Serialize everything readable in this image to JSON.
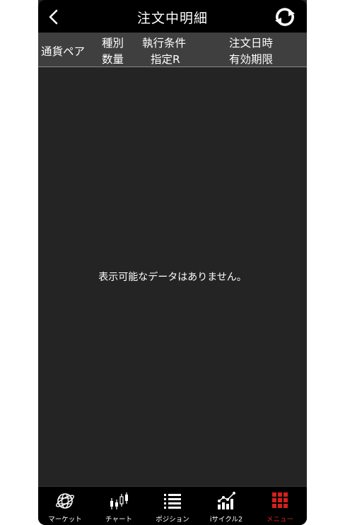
{
  "nav": {
    "title": "注文中明細"
  },
  "header": {
    "col1_line1": "通貨ペア",
    "col2_line1": "種別",
    "col2_line2": "数量",
    "col3_line1": "執行条件",
    "col3_line2": "指定R",
    "col4_line1": "注文日時",
    "col4_line2": "有効期限"
  },
  "content": {
    "empty_message": "表示可能なデータはありません。"
  },
  "tabs": [
    {
      "label": "マーケット",
      "icon": "globe-icon",
      "active": false
    },
    {
      "label": "チャート",
      "icon": "candlestick-icon",
      "active": false
    },
    {
      "label": "ポジション",
      "icon": "list-icon",
      "active": false
    },
    {
      "label": "iサイクル2",
      "icon": "trend-chart-icon",
      "active": false
    },
    {
      "label": "メニュー",
      "icon": "grid-menu-icon",
      "active": true
    }
  ],
  "colors": {
    "accent": "#d4201d",
    "background": "#242424",
    "header": "#3f3f3f",
    "bar": "#000000"
  }
}
